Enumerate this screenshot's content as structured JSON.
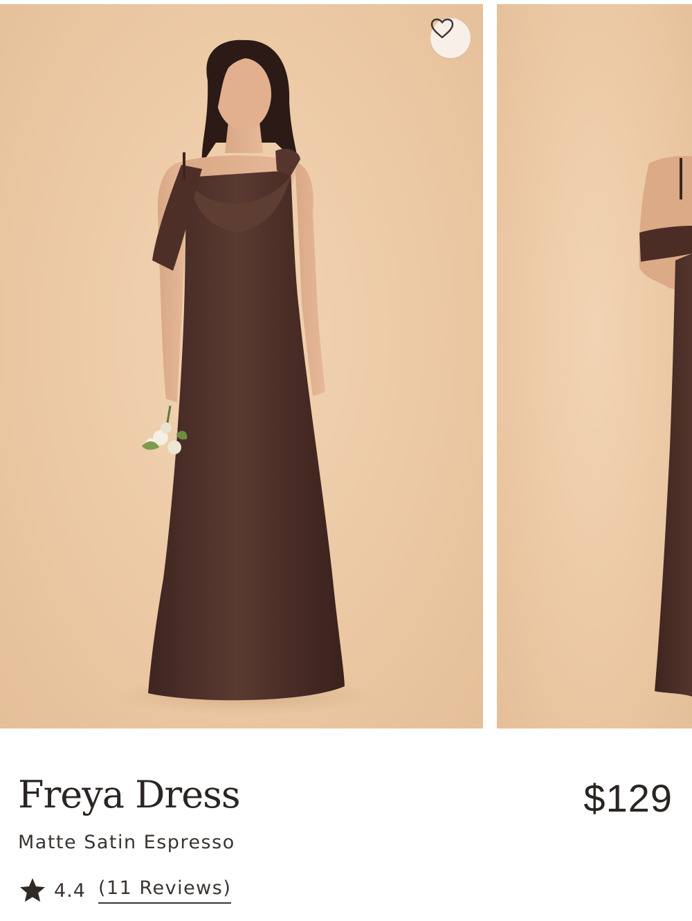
{
  "product": {
    "name": "Freya Dress",
    "color": "Matte Satin Espresso",
    "price": "$129",
    "rating": "4.4",
    "reviews_label": "(11 Reviews)"
  },
  "icons": {
    "favorite": "heart-outline-icon",
    "rating": "star-filled-icon"
  },
  "colors": {
    "background_photo": "#ecc9a5",
    "dress": "#4a2b24",
    "text": "#2a2522"
  }
}
